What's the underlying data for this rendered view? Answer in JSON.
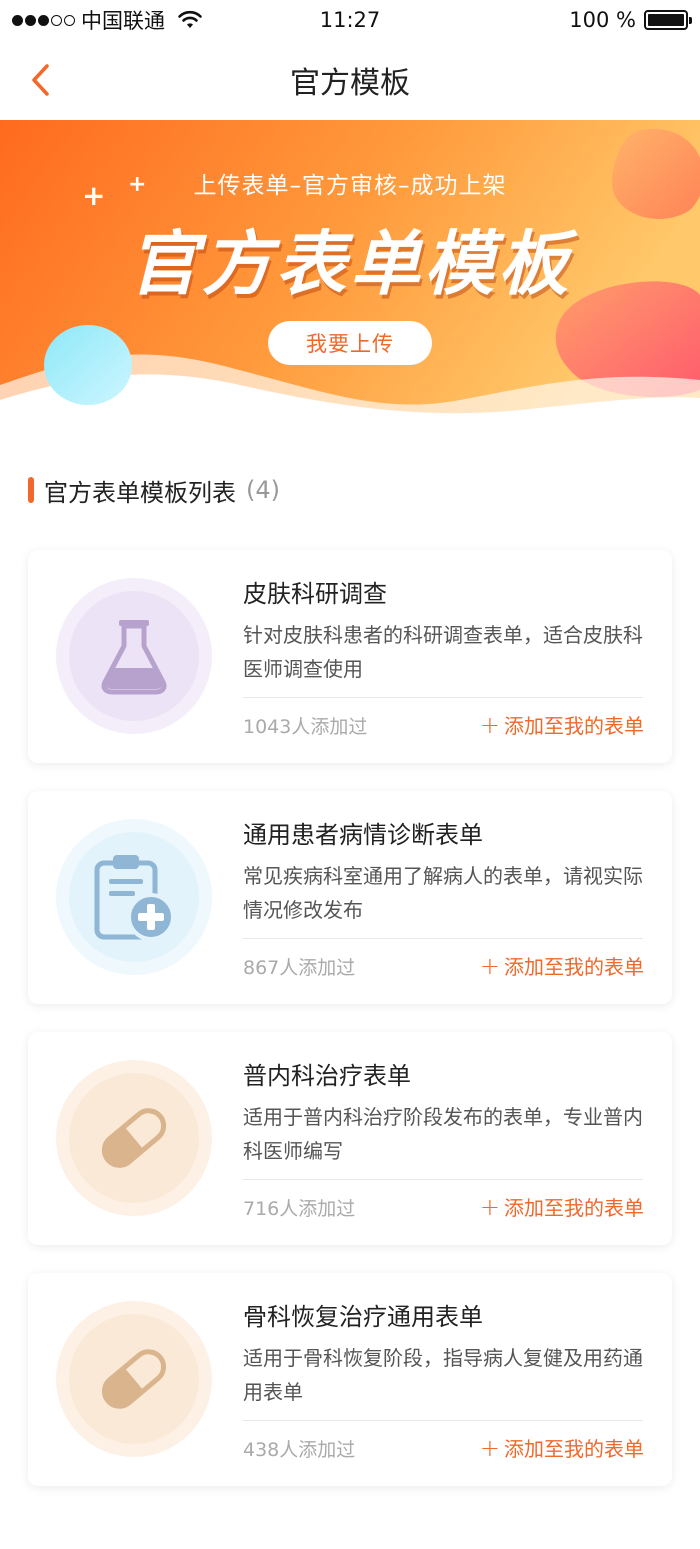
{
  "status_bar": {
    "carrier": "中国联通",
    "time": "11:27",
    "battery": "100 %"
  },
  "nav": {
    "title": "官方模板",
    "back_icon": "chevron-left-icon"
  },
  "banner": {
    "subtitle": "上传表单–官方审核–成功上架",
    "title": "官方表单模板",
    "upload_label": "我要上传"
  },
  "section": {
    "title": "官方表单模板列表",
    "count": "(4)"
  },
  "colors": {
    "accent": "#f2672a",
    "banner_start": "#ff6a1f",
    "banner_end": "#ffc96b"
  },
  "cards": [
    {
      "title": "皮肤科研调查",
      "desc": "针对皮肤科患者的科研调查表单，适合皮肤科医师调查使用",
      "count": "1043人添加过",
      "add_label": "添加至我的表单",
      "icon": "flask-icon"
    },
    {
      "title": "通用患者病情诊断表单",
      "desc": "常见疾病科室通用了解病人的表单，请视实际情况修改发布",
      "count": "867人添加过",
      "add_label": "添加至我的表单",
      "icon": "clipboard-medical-icon"
    },
    {
      "title": "普内科治疗表单",
      "desc": "适用于普内科治疗阶段发布的表单，专业普内科医师编写",
      "count": "716人添加过",
      "add_label": "添加至我的表单",
      "icon": "pill-capsule-icon"
    },
    {
      "title": "骨科恢复治疗通用表单",
      "desc": "适用于骨科恢复阶段，指导病人复健及用药通用表单",
      "count": "438人添加过",
      "add_label": "添加至我的表单",
      "icon": "pill-capsule-icon"
    }
  ]
}
